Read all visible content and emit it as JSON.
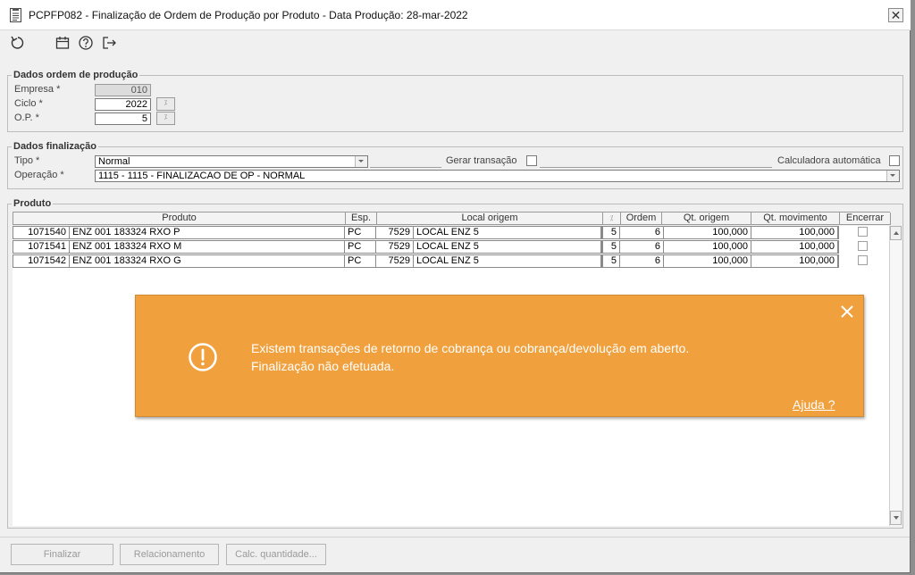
{
  "window": {
    "title": "PCPFP082 - Finalização de Ordem de Produção por Produto - Data Produção: 28-mar-2022",
    "close_label": "✕"
  },
  "toolbar": {
    "icons": [
      "refresh-icon",
      "calendar-icon",
      "help-icon",
      "exit-icon"
    ]
  },
  "ordem_producao": {
    "title": "Dados ordem de produção",
    "empresa_label": "Empresa *",
    "empresa_value": "010",
    "ciclo_label": "Ciclo *",
    "ciclo_value": "2022",
    "op_label": "O.P. *",
    "op_value": "5",
    "lookup_glyph": "⁒"
  },
  "finalizacao": {
    "title": "Dados finalização",
    "tipo_label": "Tipo *",
    "tipo_value": "Normal",
    "gerar_transacao_label": "Gerar transação",
    "calculadora_label": "Calculadora automática",
    "operacao_label": "Operação *",
    "operacao_value": "1115 - 1115 - FINALIZACAO DE OP - NORMAL"
  },
  "produto": {
    "title": "Produto",
    "columns": [
      "Produto",
      "Esp.",
      "Local origem",
      "⁒",
      "Ordem",
      "Qt. origem",
      "Qt. movimento",
      "Encerrar"
    ],
    "rows": [
      {
        "codigo": "1071540",
        "descricao": "ENZ 001 183324 RXO P",
        "esp": "PC",
        "local_cod": "7529",
        "local_desc": "LOCAL ENZ 5",
        "op": "5",
        "ordem": "6",
        "qt_origem": "100,000",
        "qt_movimento": "100,000"
      },
      {
        "codigo": "1071541",
        "descricao": "ENZ 001 183324 RXO M",
        "esp": "PC",
        "local_cod": "7529",
        "local_desc": "LOCAL ENZ 5",
        "op": "5",
        "ordem": "6",
        "qt_origem": "100,000",
        "qt_movimento": "100,000"
      },
      {
        "codigo": "1071542",
        "descricao": "ENZ 001 183324 RXO G",
        "esp": "PC",
        "local_cod": "7529",
        "local_desc": "LOCAL ENZ 5",
        "op": "5",
        "ordem": "6",
        "qt_origem": "100,000",
        "qt_movimento": "100,000"
      }
    ]
  },
  "toast": {
    "line1": "Existem transações de retorno de cobrança ou cobrança/devolução em aberto.",
    "line2": "Finalização não efetuada.",
    "help": "Ajuda ?",
    "color": "#f0a03c"
  },
  "buttons": {
    "finalizar": "Finalizar",
    "relacionamento": "Relacionamento",
    "calc_quantidade": "Calc. quantidade..."
  }
}
